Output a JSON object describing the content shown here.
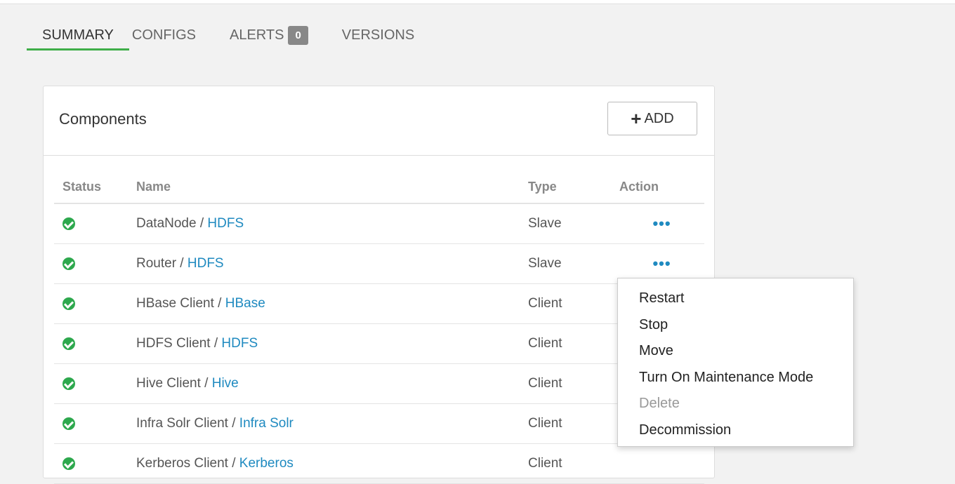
{
  "tabs": [
    {
      "label": "SUMMARY",
      "active": true
    },
    {
      "label": "CONFIGS",
      "active": false
    },
    {
      "label": "ALERTS",
      "badge": "0",
      "active": false
    },
    {
      "label": "VERSIONS",
      "active": false
    }
  ],
  "panel": {
    "title": "Components",
    "add_label": "ADD"
  },
  "table": {
    "headers": {
      "status": "Status",
      "name": "Name",
      "type": "Type",
      "action": "Action"
    },
    "rows": [
      {
        "component": "DataNode",
        "service": "HDFS",
        "type": "Slave"
      },
      {
        "component": "Router",
        "service": "HDFS",
        "type": "Slave"
      },
      {
        "component": "HBase Client",
        "service": "HBase",
        "type": "Client"
      },
      {
        "component": "HDFS Client",
        "service": "HDFS",
        "type": "Client"
      },
      {
        "component": "Hive Client",
        "service": "Hive",
        "type": "Client"
      },
      {
        "component": "Infra Solr Client",
        "service": "Infra Solr",
        "type": "Client"
      },
      {
        "component": "Kerberos Client",
        "service": "Kerberos",
        "type": "Client"
      }
    ],
    "action_glyph": "•••",
    "name_separator": " / "
  },
  "menu": {
    "items": [
      {
        "label": "Restart",
        "disabled": false
      },
      {
        "label": "Stop",
        "disabled": false
      },
      {
        "label": "Move",
        "disabled": false
      },
      {
        "label": "Turn On Maintenance Mode",
        "disabled": false
      },
      {
        "label": "Delete",
        "disabled": true
      },
      {
        "label": "Decommission",
        "disabled": false
      }
    ]
  },
  "colors": {
    "accent_green": "#3fae49",
    "status_ok": "#2da84d",
    "link_blue": "#1f8ac0"
  }
}
